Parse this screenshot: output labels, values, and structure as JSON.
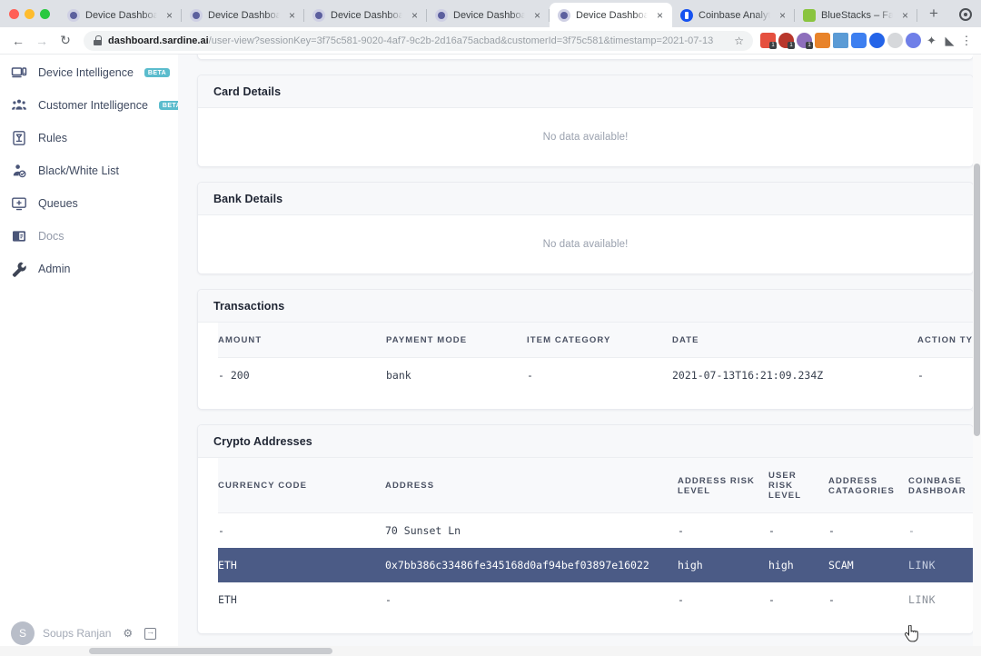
{
  "browser": {
    "tabs": [
      {
        "title": "Device Dashboard",
        "favicon": "sardine-icon",
        "active": false
      },
      {
        "title": "Device Dashboard",
        "favicon": "sardine-icon",
        "active": false
      },
      {
        "title": "Device Dashboard",
        "favicon": "sardine-icon",
        "active": false
      },
      {
        "title": "Device Dashboard",
        "favicon": "sardine-icon",
        "active": false
      },
      {
        "title": "Device Dashboard",
        "favicon": "sardine-icon",
        "active": true
      },
      {
        "title": "Coinbase Analytics",
        "favicon": "coinbase-icon",
        "active": false
      },
      {
        "title": "BlueStacks – Fastest A",
        "favicon": "bluestacks-icon",
        "active": false
      }
    ],
    "new_tab_label": "+",
    "close_label": "×",
    "nav": {
      "back": "←",
      "forward": "→",
      "reload": "↻"
    },
    "omnibox": {
      "domain": "dashboard.sardine.ai",
      "path": "/user-view?sessionKey=3f75c581-9020-4af7-9c2b-2d16a75acbad&customerId=3f75c581&timestamp=2021-07-13",
      "lock_icon": "lock-icon",
      "star_label": "☆"
    },
    "extension_badges": [
      "1",
      "1",
      "1"
    ],
    "menu_label": "⋮"
  },
  "sidebar": {
    "items": [
      {
        "label": "Device Intelligence",
        "icon": "device-icon",
        "badge": "BETA",
        "muted": false
      },
      {
        "label": "Customer Intelligence",
        "icon": "people-icon",
        "badge": "BETA",
        "muted": false
      },
      {
        "label": "Rules",
        "icon": "rules-icon",
        "badge": "",
        "muted": false
      },
      {
        "label": "Black/White List",
        "icon": "user-list-icon",
        "badge": "",
        "muted": false
      },
      {
        "label": "Queues",
        "icon": "queues-icon",
        "badge": "",
        "muted": false
      },
      {
        "label": "Docs",
        "icon": "docs-icon",
        "badge": "",
        "muted": true
      },
      {
        "label": "Admin",
        "icon": "wrench-icon",
        "badge": "",
        "muted": false
      }
    ],
    "user": {
      "initial": "S",
      "name": "Soups Ranjan",
      "settings_icon": "gear-icon",
      "logout_icon": "logout-icon"
    }
  },
  "main": {
    "empty_text": "No data available!",
    "cards": {
      "card_details": {
        "title": "Card Details"
      },
      "bank_details": {
        "title": "Bank Details"
      },
      "transactions": {
        "title": "Transactions",
        "columns": [
          "AMOUNT",
          "PAYMENT MODE",
          "ITEM CATEGORY",
          "DATE",
          "ACTION TYPE"
        ],
        "rows": [
          {
            "amount": "-  200",
            "payment_mode": "bank",
            "item_category": "-",
            "date": "2021-07-13T16:21:09.234Z",
            "action_type": "-"
          }
        ]
      },
      "crypto_addresses": {
        "title": "Crypto Addresses",
        "columns": [
          "CURRENCY CODE",
          "ADDRESS",
          "ADDRESS RISK LEVEL",
          "USER RISK LEVEL",
          "ADDRESS CATAGORIES",
          "COINBASE DASHBOAR"
        ],
        "rows": [
          {
            "currency_code": "-",
            "address": "70 Sunset Ln",
            "address_risk_level": "-",
            "user_risk_level": "-",
            "address_catagories": "-",
            "coinbase_dashboard": "-",
            "selected": false
          },
          {
            "currency_code": "ETH",
            "address": "0x7bb386c33486fe345168d0af94bef03897e16022",
            "address_risk_level": "high",
            "user_risk_level": "high",
            "address_catagories": "SCAM",
            "coinbase_dashboard": "LINK",
            "selected": true
          },
          {
            "currency_code": "ETH",
            "address": "-",
            "address_risk_level": "-",
            "user_risk_level": "-",
            "address_catagories": "-",
            "coinbase_dashboard": "LINK",
            "selected": false
          }
        ]
      }
    }
  },
  "colors": {
    "selected_row": "#4b5b86",
    "beta_badge": "#5bbccd",
    "page_bg": "#f7f8fa",
    "text_primary": "#1f2533"
  }
}
